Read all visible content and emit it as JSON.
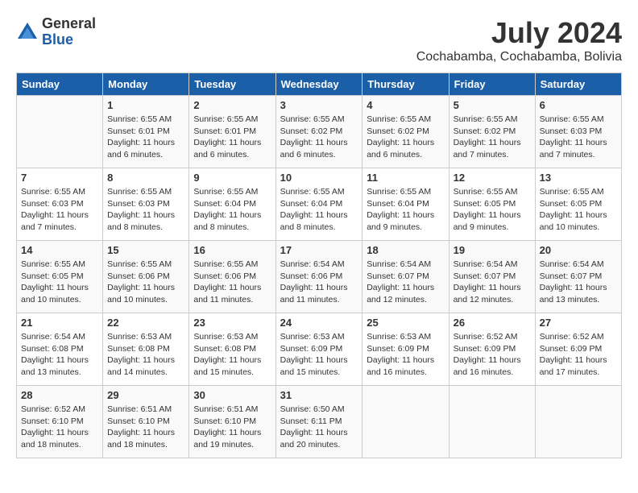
{
  "logo": {
    "general": "General",
    "blue": "Blue"
  },
  "title": "July 2024",
  "location": "Cochabamba, Cochabamba, Bolivia",
  "weekdays": [
    "Sunday",
    "Monday",
    "Tuesday",
    "Wednesday",
    "Thursday",
    "Friday",
    "Saturday"
  ],
  "weeks": [
    [
      {
        "day": "",
        "info": ""
      },
      {
        "day": "1",
        "info": "Sunrise: 6:55 AM\nSunset: 6:01 PM\nDaylight: 11 hours\nand 6 minutes."
      },
      {
        "day": "2",
        "info": "Sunrise: 6:55 AM\nSunset: 6:01 PM\nDaylight: 11 hours\nand 6 minutes."
      },
      {
        "day": "3",
        "info": "Sunrise: 6:55 AM\nSunset: 6:02 PM\nDaylight: 11 hours\nand 6 minutes."
      },
      {
        "day": "4",
        "info": "Sunrise: 6:55 AM\nSunset: 6:02 PM\nDaylight: 11 hours\nand 6 minutes."
      },
      {
        "day": "5",
        "info": "Sunrise: 6:55 AM\nSunset: 6:02 PM\nDaylight: 11 hours\nand 7 minutes."
      },
      {
        "day": "6",
        "info": "Sunrise: 6:55 AM\nSunset: 6:03 PM\nDaylight: 11 hours\nand 7 minutes."
      }
    ],
    [
      {
        "day": "7",
        "info": "Sunrise: 6:55 AM\nSunset: 6:03 PM\nDaylight: 11 hours\nand 7 minutes."
      },
      {
        "day": "8",
        "info": "Sunrise: 6:55 AM\nSunset: 6:03 PM\nDaylight: 11 hours\nand 8 minutes."
      },
      {
        "day": "9",
        "info": "Sunrise: 6:55 AM\nSunset: 6:04 PM\nDaylight: 11 hours\nand 8 minutes."
      },
      {
        "day": "10",
        "info": "Sunrise: 6:55 AM\nSunset: 6:04 PM\nDaylight: 11 hours\nand 8 minutes."
      },
      {
        "day": "11",
        "info": "Sunrise: 6:55 AM\nSunset: 6:04 PM\nDaylight: 11 hours\nand 9 minutes."
      },
      {
        "day": "12",
        "info": "Sunrise: 6:55 AM\nSunset: 6:05 PM\nDaylight: 11 hours\nand 9 minutes."
      },
      {
        "day": "13",
        "info": "Sunrise: 6:55 AM\nSunset: 6:05 PM\nDaylight: 11 hours\nand 10 minutes."
      }
    ],
    [
      {
        "day": "14",
        "info": "Sunrise: 6:55 AM\nSunset: 6:05 PM\nDaylight: 11 hours\nand 10 minutes."
      },
      {
        "day": "15",
        "info": "Sunrise: 6:55 AM\nSunset: 6:06 PM\nDaylight: 11 hours\nand 10 minutes."
      },
      {
        "day": "16",
        "info": "Sunrise: 6:55 AM\nSunset: 6:06 PM\nDaylight: 11 hours\nand 11 minutes."
      },
      {
        "day": "17",
        "info": "Sunrise: 6:54 AM\nSunset: 6:06 PM\nDaylight: 11 hours\nand 11 minutes."
      },
      {
        "day": "18",
        "info": "Sunrise: 6:54 AM\nSunset: 6:07 PM\nDaylight: 11 hours\nand 12 minutes."
      },
      {
        "day": "19",
        "info": "Sunrise: 6:54 AM\nSunset: 6:07 PM\nDaylight: 11 hours\nand 12 minutes."
      },
      {
        "day": "20",
        "info": "Sunrise: 6:54 AM\nSunset: 6:07 PM\nDaylight: 11 hours\nand 13 minutes."
      }
    ],
    [
      {
        "day": "21",
        "info": "Sunrise: 6:54 AM\nSunset: 6:08 PM\nDaylight: 11 hours\nand 13 minutes."
      },
      {
        "day": "22",
        "info": "Sunrise: 6:53 AM\nSunset: 6:08 PM\nDaylight: 11 hours\nand 14 minutes."
      },
      {
        "day": "23",
        "info": "Sunrise: 6:53 AM\nSunset: 6:08 PM\nDaylight: 11 hours\nand 15 minutes."
      },
      {
        "day": "24",
        "info": "Sunrise: 6:53 AM\nSunset: 6:09 PM\nDaylight: 11 hours\nand 15 minutes."
      },
      {
        "day": "25",
        "info": "Sunrise: 6:53 AM\nSunset: 6:09 PM\nDaylight: 11 hours\nand 16 minutes."
      },
      {
        "day": "26",
        "info": "Sunrise: 6:52 AM\nSunset: 6:09 PM\nDaylight: 11 hours\nand 16 minutes."
      },
      {
        "day": "27",
        "info": "Sunrise: 6:52 AM\nSunset: 6:09 PM\nDaylight: 11 hours\nand 17 minutes."
      }
    ],
    [
      {
        "day": "28",
        "info": "Sunrise: 6:52 AM\nSunset: 6:10 PM\nDaylight: 11 hours\nand 18 minutes."
      },
      {
        "day": "29",
        "info": "Sunrise: 6:51 AM\nSunset: 6:10 PM\nDaylight: 11 hours\nand 18 minutes."
      },
      {
        "day": "30",
        "info": "Sunrise: 6:51 AM\nSunset: 6:10 PM\nDaylight: 11 hours\nand 19 minutes."
      },
      {
        "day": "31",
        "info": "Sunrise: 6:50 AM\nSunset: 6:11 PM\nDaylight: 11 hours\nand 20 minutes."
      },
      {
        "day": "",
        "info": ""
      },
      {
        "day": "",
        "info": ""
      },
      {
        "day": "",
        "info": ""
      }
    ]
  ]
}
